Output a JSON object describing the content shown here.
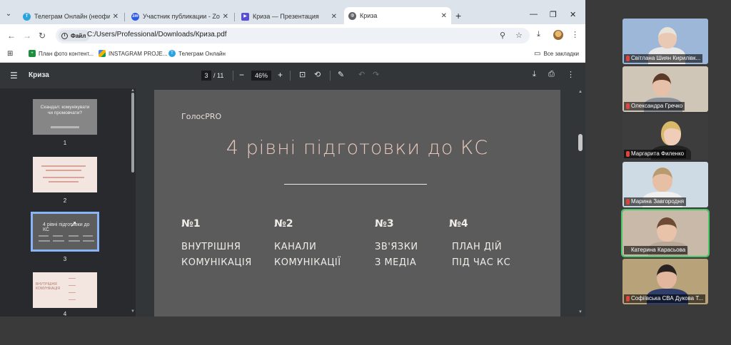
{
  "tabs": [
    {
      "title": "Телеграм Онлайн (неофициал",
      "icon": "telegram-icon",
      "color": "#2aa3e0",
      "active": false
    },
    {
      "title": "Участник публикации - Zoom",
      "icon": "zoom-icon",
      "color": "#2d59e8",
      "active": false
    },
    {
      "title": "Криза — Презентация",
      "icon": "slides-icon",
      "color": "#5b4bd6",
      "active": false
    },
    {
      "title": "Криза",
      "icon": "globe-icon",
      "color": "#5f6368",
      "active": true
    }
  ],
  "toolbar": {
    "file_label": "Файл",
    "url": "C:/Users/Professional/Downloads/Криза.pdf"
  },
  "bookmarks": {
    "items": [
      {
        "label": "План фото контент...",
        "icon": "sheets-icon",
        "color": "#1e8e3e"
      },
      {
        "label": "INSTAGRAM PROJE...",
        "icon": "drive-icon",
        "color": "#f4b400"
      },
      {
        "label": "Телеграм Онлайн",
        "icon": "telegram-icon",
        "color": "#2aa3e0"
      }
    ],
    "all_label": "Все закладки"
  },
  "pdf": {
    "title": "Криза",
    "page_current": "3",
    "page_total": "/ 11",
    "zoom": "46%"
  },
  "thumbnails": [
    {
      "num": "1",
      "text": "Скандал: комунікувати чи промовчати?"
    },
    {
      "num": "2"
    },
    {
      "num": "3",
      "text": "4 рівні підготовки до КС"
    },
    {
      "num": "4",
      "text": "ВНУТРІШНЯ КОМУНІКАЦІЯ"
    }
  ],
  "slide": {
    "brand": "ГолосPRO",
    "title": "4 рівні підготовки до КС",
    "columns": [
      {
        "num": "№1",
        "label": "ВНУТРІШНЯ\nКОМУНІКАЦІЯ"
      },
      {
        "num": "№2",
        "label": "КАНАЛИ\nКОМУНІКАЦІЇ"
      },
      {
        "num": "№3",
        "label": "ЗВ'ЯЗКИ\nЗ МЕДІА"
      },
      {
        "num": "№4",
        "label": "ПЛАН ДІЙ\nПІД ЧАС КС"
      }
    ]
  },
  "participants": [
    {
      "name": "Світлана Шиян Кирилівк...",
      "bg": "#9db7d8",
      "skin": "#e9c9b3",
      "hair": "#e8e4da",
      "shirt": "#e8e8e8",
      "speaking": false
    },
    {
      "name": "Олександра Гречко",
      "bg": "#cfc6b8",
      "skin": "#e6c0a8",
      "hair": "#5b3a2a",
      "shirt": "#8a8f98",
      "speaking": false
    },
    {
      "name": "Маргарита Филенко",
      "bg": "#3d3d3d",
      "skin": "#f0cdb8",
      "hair": "#d9b86a",
      "shirt": "#222222",
      "speaking": false
    },
    {
      "name": "Марина Завгородня",
      "bg": "#cfdbe4",
      "skin": "#e6bfa5",
      "hair": "#b89a6e",
      "shirt": "#f0f0f0",
      "speaking": false
    },
    {
      "name": "Катерина Карасьова",
      "bg": "#c9b9a9",
      "skin": "#e8c3aa",
      "hair": "#6d4a35",
      "shirt": "#b8a898",
      "speaking": true
    },
    {
      "name": "Софіївська СВА Дукова Т...",
      "bg": "#b8a27a",
      "skin": "#e3b79e",
      "hair": "#2a2220",
      "shirt": "#2f3e6b",
      "speaking": false
    }
  ]
}
